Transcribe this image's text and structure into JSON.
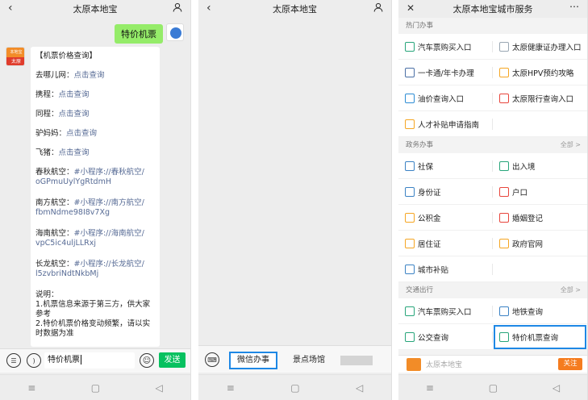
{
  "phone1": {
    "title": "太原本地宝",
    "my_message": "特价机票",
    "bot_avatar": {
      "top": "本地宝",
      "bottom": "太原"
    },
    "bubble": {
      "heading": "【机票价格查询】",
      "links": [
        {
          "label": "去哪儿网：",
          "action": "点击查询"
        },
        {
          "label": "携程：",
          "action": "点击查询"
        },
        {
          "label": "同程：",
          "action": "点击查询"
        },
        {
          "label": "驴妈妈：",
          "action": "点击查询"
        },
        {
          "label": "飞猪：",
          "action": "点击查询"
        }
      ],
      "airlines": [
        {
          "label": "春秋航空：",
          "mini": "#小程序://春秋航空/",
          "code": "oGPmuUylYgRtdmH"
        },
        {
          "label": "南方航空：",
          "mini": "#小程序://南方航空/",
          "code": "fbmNdme98I8v7Xg"
        },
        {
          "label": "海南航空：",
          "mini": "#小程序://海南航空/",
          "code": "vpC5ic4uljLLRxj"
        },
        {
          "label": "长龙航空：",
          "mini": "#小程序://长龙航空/",
          "code": "l5zvbriNdtNkbMj"
        }
      ],
      "note_title": "说明：",
      "note1": "1.机票信息来源于第三方，供大家参考",
      "note2": "2.特价机票价格变动频繁，请以实时数据为准"
    },
    "input_value": "特价机票",
    "send_label": "发送"
  },
  "phone2": {
    "title": "太原本地宝",
    "menu1": "微信办事",
    "menu2": "景点场馆"
  },
  "phone3": {
    "title": "太原本地宝城市服务",
    "sections": [
      {
        "title": "热门办事",
        "all": "",
        "items": [
          {
            "label": "汽车票购买入口",
            "color": "#27a57a"
          },
          {
            "label": "太原健康证办理入口",
            "color": "#9aa7b3"
          },
          {
            "label": "一卡通/年卡办理",
            "color": "#4a6fa5"
          },
          {
            "label": "太原HPV预约攻略",
            "color": "#f5a623"
          },
          {
            "label": "油价查询入口",
            "color": "#2c8cd4"
          },
          {
            "label": "太原限行查询入口",
            "color": "#e8453c"
          },
          {
            "label": "人才补贴申请指南",
            "color": "#f5a623"
          }
        ]
      },
      {
        "title": "政务办事",
        "all": "全部 >",
        "items": [
          {
            "label": "社保",
            "color": "#3b82c4"
          },
          {
            "label": "出入境",
            "color": "#27a57a"
          },
          {
            "label": "身份证",
            "color": "#3b82c4"
          },
          {
            "label": "户口",
            "color": "#e8453c"
          },
          {
            "label": "公积金",
            "color": "#f5a623"
          },
          {
            "label": "婚姻登记",
            "color": "#e8453c"
          },
          {
            "label": "居住证",
            "color": "#f5a623"
          },
          {
            "label": "政府官网",
            "color": "#f5a623"
          },
          {
            "label": "城市补贴",
            "color": "#3b82c4"
          }
        ]
      },
      {
        "title": "交通出行",
        "all": "全部 >",
        "items": [
          {
            "label": "汽车票购买入口",
            "color": "#27a57a"
          },
          {
            "label": "地铁查询",
            "color": "#3b82c4"
          },
          {
            "label": "公交查询",
            "color": "#27a57a"
          },
          {
            "label": "特价机票查询",
            "color": "#27a57a"
          }
        ]
      }
    ],
    "footer_name": "太原本地宝",
    "follow_label": "关注"
  }
}
